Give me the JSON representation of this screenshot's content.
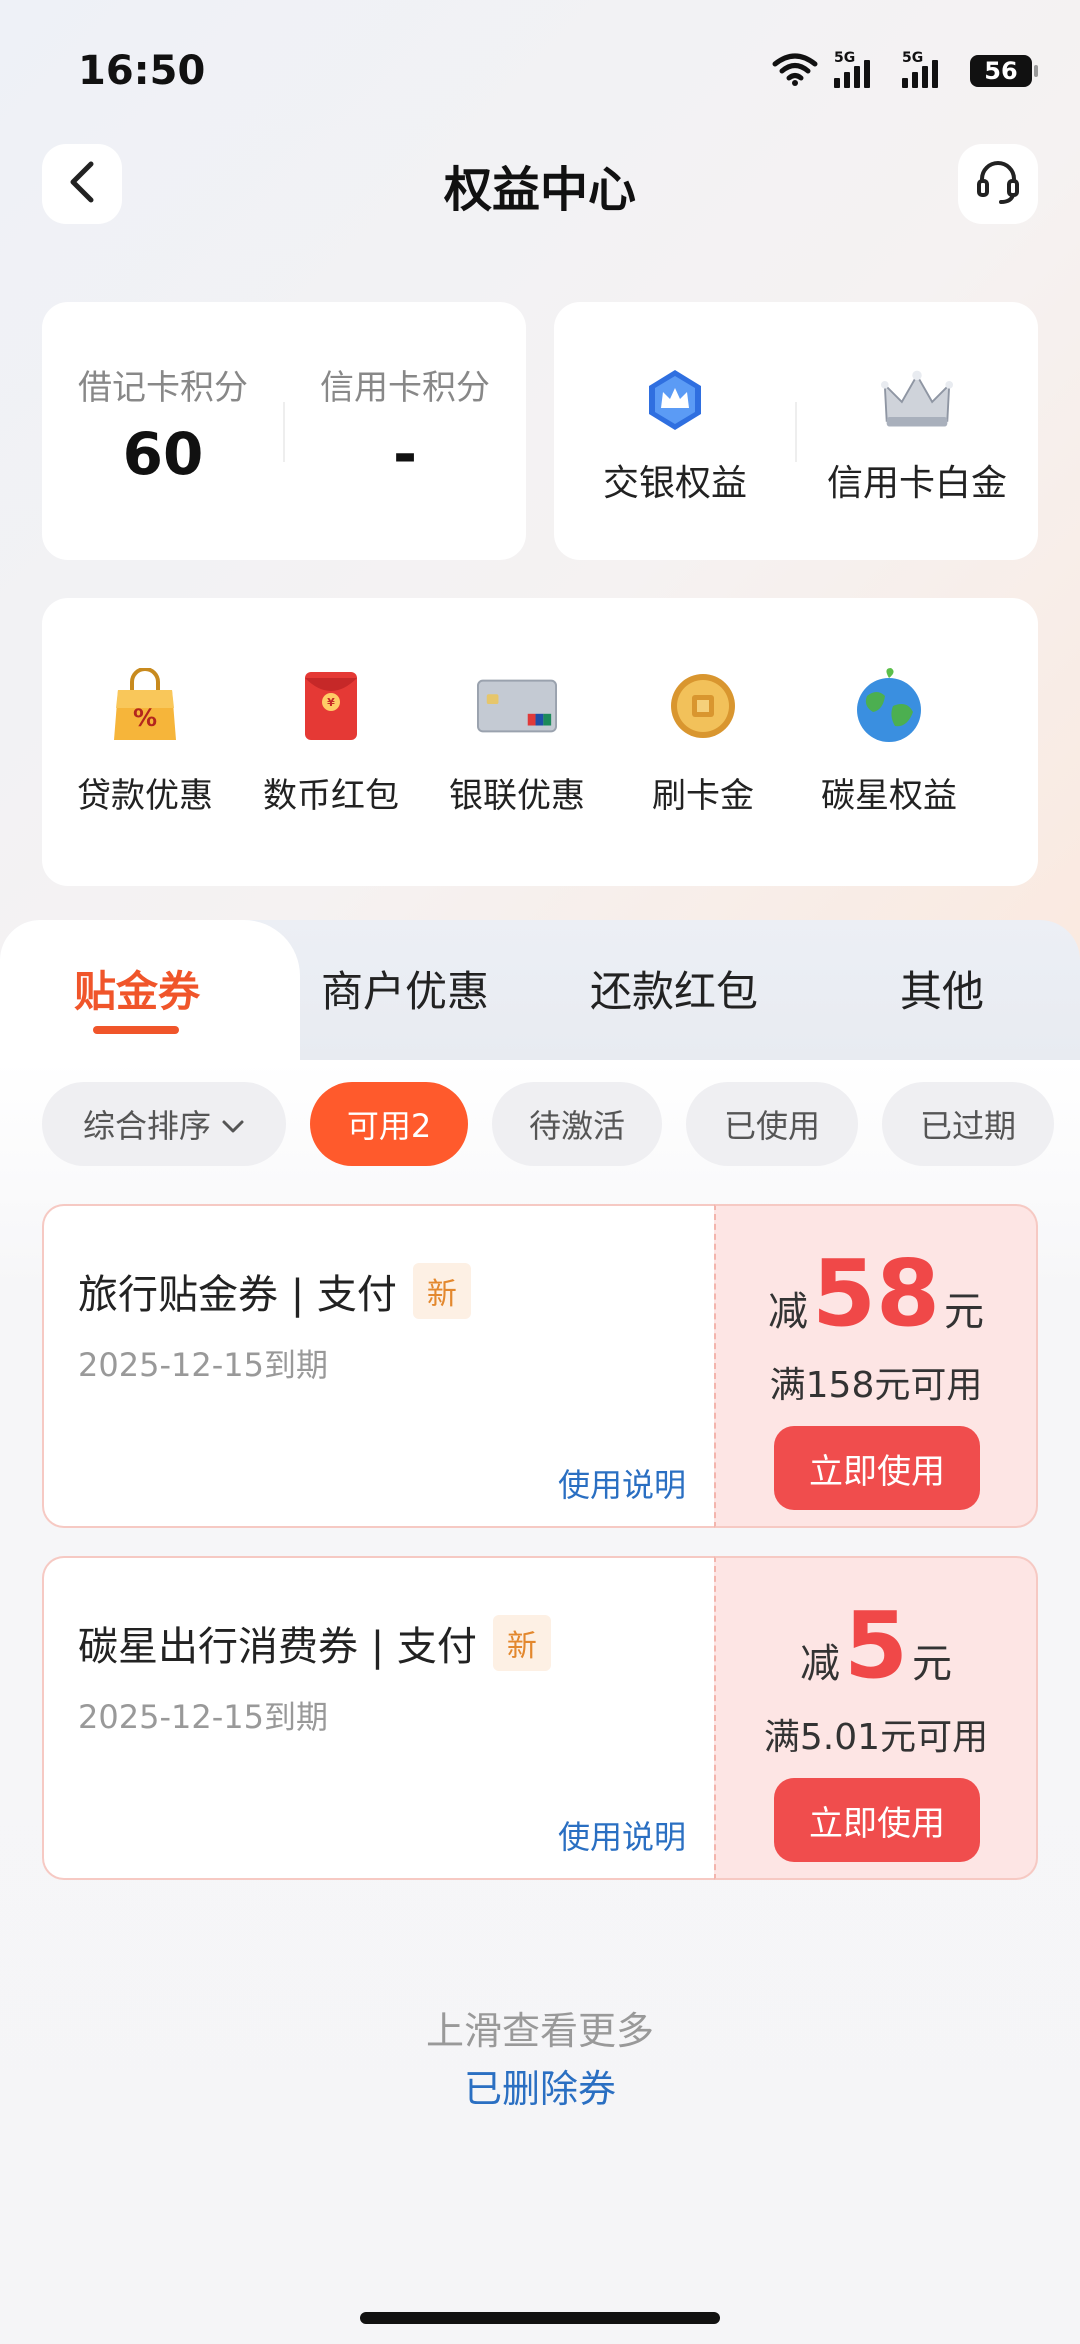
{
  "status_bar": {
    "time": "16:50",
    "net1": "5G",
    "net2": "5G",
    "battery": "56"
  },
  "header": {
    "title": "权益中心"
  },
  "points": [
    {
      "label": "借记卡积分",
      "value": "60"
    },
    {
      "label": "信用卡积分",
      "value": "-"
    }
  ],
  "rights": [
    {
      "label": "交银权益",
      "icon": "crown-badge-icon"
    },
    {
      "label": "信用卡白金",
      "icon": "silver-crown-icon"
    }
  ],
  "menu": [
    {
      "label": "贷款优惠",
      "icon": "shopping-bag-icon"
    },
    {
      "label": "数币红包",
      "icon": "red-envelope-icon"
    },
    {
      "label": "银联优惠",
      "icon": "unionpay-card-icon"
    },
    {
      "label": "刷卡金",
      "icon": "gold-coin-icon"
    },
    {
      "label": "碳星权益",
      "icon": "earth-icon"
    }
  ],
  "tabs": [
    "贴金券",
    "商户优惠",
    "还款红包",
    "其他"
  ],
  "filters": {
    "sort": "综合排序",
    "chips": [
      "可用2",
      "待激活",
      "已使用",
      "已过期"
    ]
  },
  "coupons": [
    {
      "title": "旅行贴金券 | 支付",
      "badge": "新",
      "expiry": "2025-12-15到期",
      "help": "使用说明",
      "prefix": "减",
      "amount": "58",
      "suffix": "元",
      "condition": "满158元可用",
      "button": "立即使用"
    },
    {
      "title": "碳星出行消费券 | 支付",
      "badge": "新",
      "expiry": "2025-12-15到期",
      "help": "使用说明",
      "prefix": "减",
      "amount": "5",
      "suffix": "元",
      "condition": "满5.01元可用",
      "button": "立即使用"
    }
  ],
  "footer": {
    "hint": "上滑查看更多",
    "deleted": "已删除券"
  },
  "colors": {
    "accent": "#ff5a2c",
    "coupon_red": "#f04848",
    "link": "#2a6fc2"
  }
}
